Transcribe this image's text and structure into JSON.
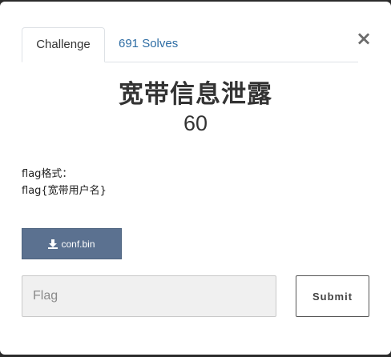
{
  "modal": {
    "close_symbol": "×",
    "tabs": [
      {
        "label": "Challenge"
      },
      {
        "label": "691 Solves"
      }
    ],
    "challenge": {
      "name": "宽带信息泄露",
      "points": "60",
      "description_lines": [
        "flag格式：",
        "flag{宽带用户名}"
      ],
      "file": {
        "label": "conf.bin",
        "icon": "download-icon"
      }
    },
    "flag_input": {
      "placeholder": "Flag",
      "value": ""
    },
    "submit_label": "Submit"
  },
  "colors": {
    "download_button_bg": "#5b7190",
    "tab_link": "#2e6da4",
    "input_bg": "#f0f0f0"
  }
}
